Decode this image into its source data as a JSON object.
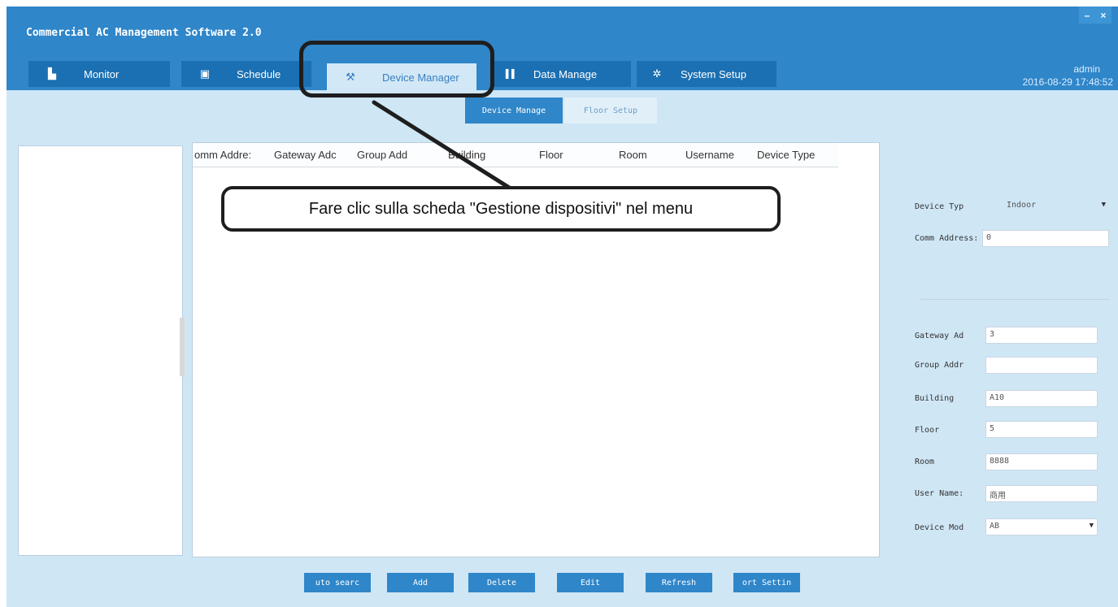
{
  "window": {
    "title": "Commercial AC Management Software 2.0",
    "minimize_label": "–",
    "close_label": "×"
  },
  "tabs": [
    {
      "label": "Monitor",
      "icon": "monitor-icon",
      "icon_glyph": "▙"
    },
    {
      "label": "Schedule",
      "icon": "calendar-icon",
      "icon_glyph": "▣"
    },
    {
      "label": "Device Manager",
      "icon": "wrench-icon",
      "icon_glyph": "⚒"
    },
    {
      "label": "Data Manage",
      "icon": "bar-chart-icon",
      "icon_glyph": "▌▌"
    },
    {
      "label": "System Setup",
      "icon": "gear-icon",
      "icon_glyph": "✲"
    }
  ],
  "user": {
    "name": "admin",
    "datetime": "2016-08-29 17:48:52"
  },
  "subtabs": [
    "Device Manage",
    "Floor Setup"
  ],
  "table": {
    "columns": [
      "omm Addre:",
      "Gateway Adc",
      "Group Add",
      "Building",
      "Floor",
      "Room",
      "Username",
      "Device Type"
    ],
    "rows": []
  },
  "callout": {
    "text": "Fare clic sulla scheda \"Gestione dispositivi\" nel menu"
  },
  "form": {
    "device_type": {
      "label": "Device Typ",
      "value": "Indoor"
    },
    "comm_address": {
      "label": "Comm Address:",
      "value": "0"
    },
    "gateway_address": {
      "label": "Gateway Ad",
      "value": "3"
    },
    "group_address": {
      "label": "Group Addr",
      "value": ""
    },
    "building": {
      "label": "Building",
      "value": "A10"
    },
    "floor": {
      "label": "Floor",
      "value": "5"
    },
    "room": {
      "label": "Room",
      "value": "8888"
    },
    "user_name": {
      "label": "User Name:",
      "value": "商用"
    },
    "device_model": {
      "label": "Device Mod",
      "value": "AB"
    }
  },
  "buttons": {
    "auto_search": "uto searc",
    "add": "Add",
    "delete": "Delete",
    "edit": "Edit",
    "refresh": "Refresh",
    "port_setting": "ort Settin"
  },
  "colors": {
    "titlebar": "#2f86c9",
    "tab": "#1b70b3",
    "panel_bg": "#cfe6f5",
    "accent": "#2f86c9"
  }
}
